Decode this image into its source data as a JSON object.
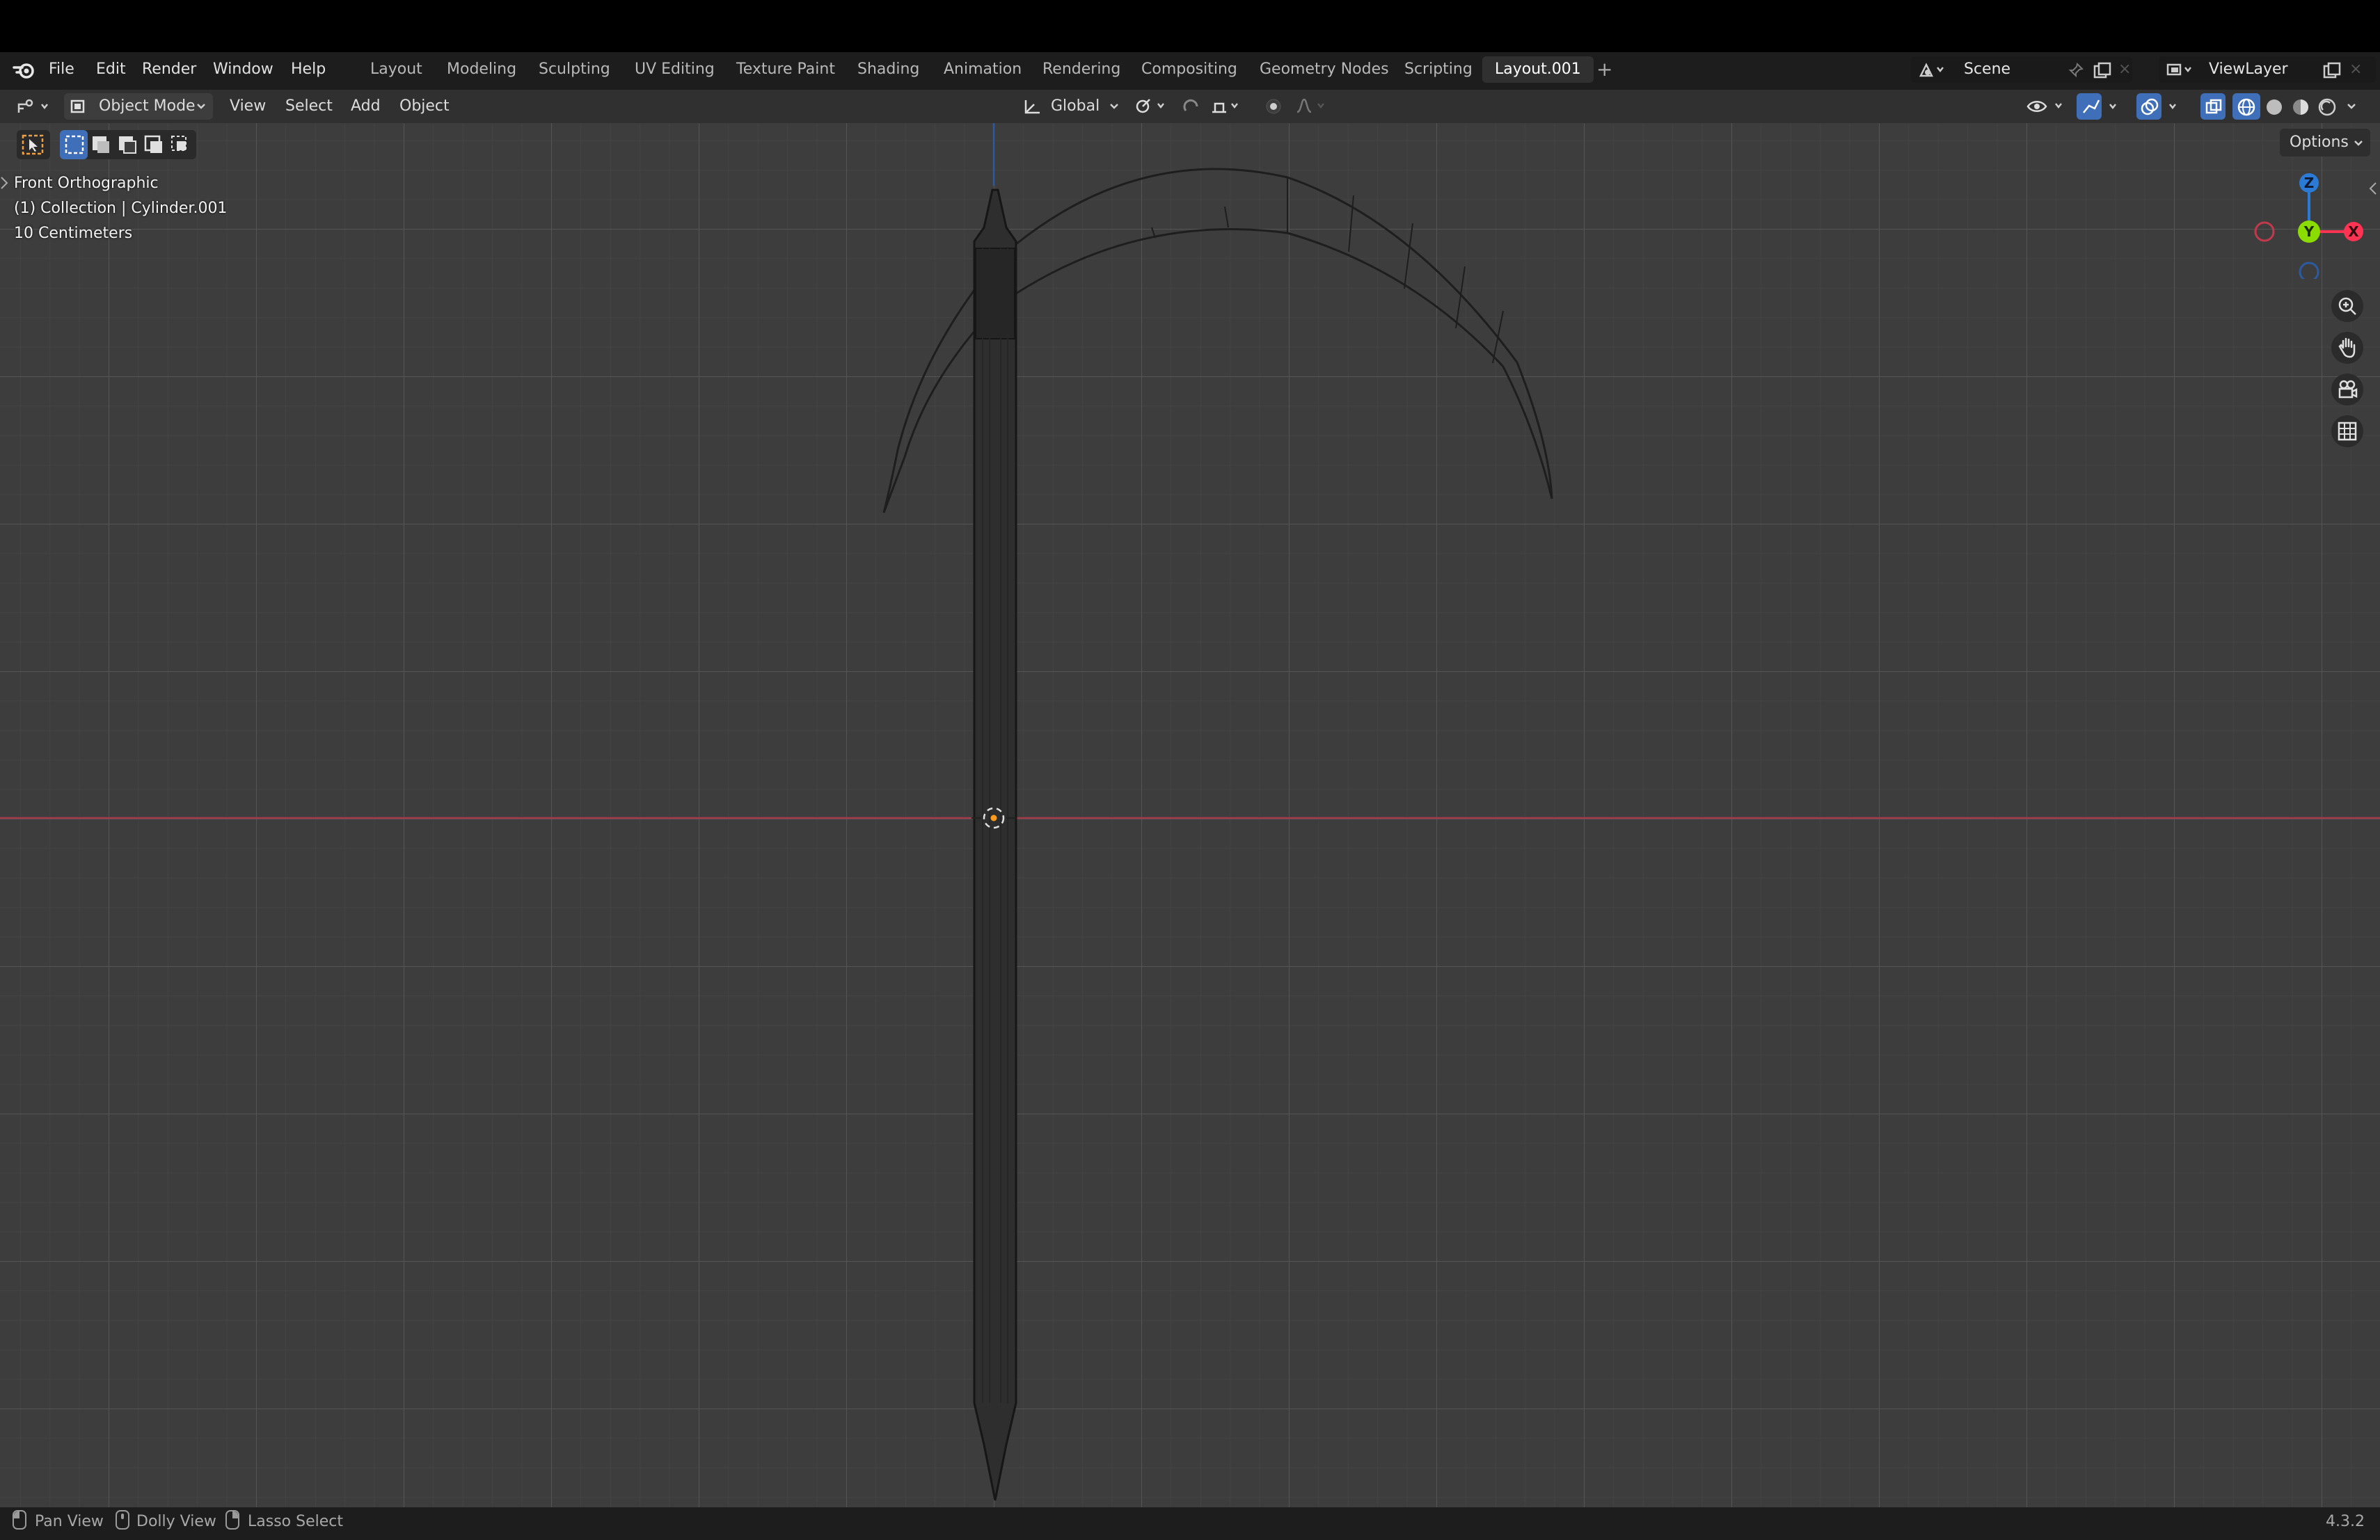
{
  "app": {
    "version": "4.3.2"
  },
  "menu": {
    "items": [
      "File",
      "Edit",
      "Render",
      "Window",
      "Help"
    ]
  },
  "workspaces": {
    "tabs": [
      "Layout",
      "Modeling",
      "Sculpting",
      "UV Editing",
      "Texture Paint",
      "Shading",
      "Animation",
      "Rendering",
      "Compositing",
      "Geometry Nodes",
      "Scripting",
      "Layout.001"
    ],
    "active": "Layout.001"
  },
  "scene": {
    "name": "Scene"
  },
  "view_layer": {
    "name": "ViewLayer"
  },
  "header": {
    "mode": "Object Mode",
    "menus": [
      "View",
      "Select",
      "Add",
      "Object"
    ],
    "transform_orientation": "Global",
    "options_label": "Options"
  },
  "viewport": {
    "view_name": "Front Orthographic",
    "collection_info": "(1) Collection | Cylinder.001",
    "grid_scale": "10 Centimeters"
  },
  "gizmo": {
    "z": "Z",
    "y": "Y",
    "x": "X"
  },
  "status": {
    "items": [
      "Pan View",
      "Dolly View",
      "Lasso Select"
    ]
  },
  "colors": {
    "x_axis": "#ff3352",
    "y_axis": "#8bdc00",
    "z_axis": "#2b7bd6",
    "active_tab_bg": "#303030",
    "viewport_bg": "#3d3d3d"
  },
  "icons": [
    "blender-logo-icon",
    "editor-type-icon",
    "object-mode-icon",
    "transform-orientation-icon",
    "pivot-icon",
    "snap-icon",
    "proportional-edit-icon",
    "visibility-icon",
    "gizmo-icon",
    "overlay-icon",
    "xray-icon",
    "wireframe-shading-icon",
    "solid-shading-icon",
    "material-shading-icon",
    "rendered-shading-icon",
    "zoom-icon",
    "hand-icon",
    "camera-icon",
    "grid-icon"
  ]
}
